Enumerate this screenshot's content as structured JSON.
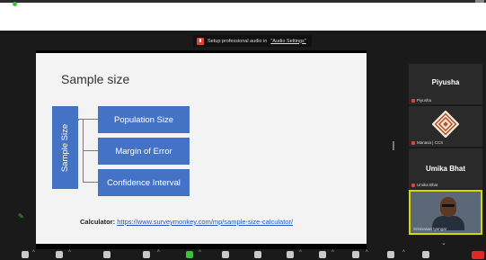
{
  "notice": {
    "prefix": "Setup professional audio in",
    "link": "\"Audio Settings\""
  },
  "slide": {
    "title": "Sample size",
    "side_label": "Sample Size",
    "boxes": [
      "Population Size",
      "Margin of Error",
      "Confidence Interval"
    ],
    "calculator_label": "Calculator:",
    "calculator_url": "https://www.surveymonkey.com/mp/sample-size-calculator/"
  },
  "participants": [
    {
      "display": "Piyusha",
      "label": "Piyusha"
    },
    {
      "display": "",
      "label": "Manasa | CCS"
    },
    {
      "display": "Umika Bhat",
      "label": "Umika Bhat"
    },
    {
      "display": "",
      "label": "Srinivasan Iyengar"
    }
  ],
  "colors": {
    "box_fill": "#4472c4",
    "active_speaker": "#d7d700",
    "mic_muted": "#e4403a",
    "end_button": "#e02828"
  },
  "toolbar_icons": [
    "mic-icon",
    "video-icon",
    "security-icon",
    "participants-icon",
    "chat-icon",
    "share-screen-icon",
    "record-icon",
    "reactions-icon",
    "apps-icon",
    "whiteboard-icon",
    "notes-icon",
    "more-icon",
    "end-icon"
  ]
}
